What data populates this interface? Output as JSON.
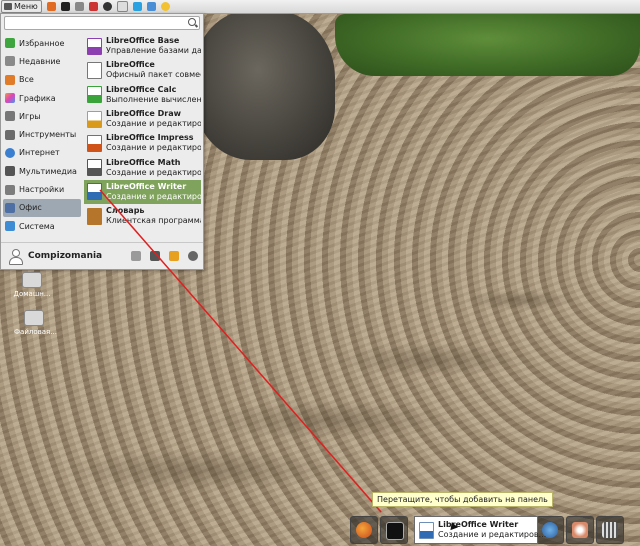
{
  "top_panel": {
    "menu_label": "Меню",
    "launchers": [
      "firefox-icon",
      "terminal-icon",
      "files-icon",
      "chromium-icon",
      "settings-icon",
      "folder-icon",
      "skype-icon",
      "mail-icon",
      "smile-icon"
    ]
  },
  "menu": {
    "search_placeholder": "",
    "categories": [
      {
        "label": "Избранное",
        "icon": "favorites-icon",
        "color": "#3fa63f"
      },
      {
        "label": "Недавние",
        "icon": "recent-icon",
        "color": "#8a8a8a"
      },
      {
        "label": "Все",
        "icon": "all-icon",
        "color": "#e07b2a"
      },
      {
        "label": "Графика",
        "icon": "graphics-icon",
        "color": "#d94fb0"
      },
      {
        "label": "Игры",
        "icon": "games-icon",
        "color": "#777777"
      },
      {
        "label": "Инструменты",
        "icon": "tools-icon",
        "color": "#6b6b6b"
      },
      {
        "label": "Интернет",
        "icon": "internet-icon",
        "color": "#3b7fd1"
      },
      {
        "label": "Мультимедиа",
        "icon": "multimedia-icon",
        "color": "#555555"
      },
      {
        "label": "Настройки",
        "icon": "settings-icon",
        "color": "#7d7d7d"
      },
      {
        "label": "Офис",
        "icon": "office-icon",
        "color": "#4d6fa3"
      },
      {
        "label": "Система",
        "icon": "system-icon",
        "color": "#3e8dd4"
      }
    ],
    "active_category": "Офис",
    "apps": [
      {
        "name": "LibreOffice Base",
        "desc": "Управление базами дан...",
        "icon": "libreoffice-base-icon",
        "accent": "#8b3fb0"
      },
      {
        "name": "LibreOffice",
        "desc": "Офисный пакет совмес...",
        "icon": "libreoffice-icon",
        "accent": "#777777"
      },
      {
        "name": "LibreOffice Calc",
        "desc": "Выполнение вычислен...",
        "icon": "libreoffice-calc-icon",
        "accent": "#3aa33a"
      },
      {
        "name": "LibreOffice Draw",
        "desc": "Создание и редактиров...",
        "icon": "libreoffice-draw-icon",
        "accent": "#d99a1c"
      },
      {
        "name": "LibreOffice Impress",
        "desc": "Создание и редактиров...",
        "icon": "libreoffice-impress-icon",
        "accent": "#d0541a"
      },
      {
        "name": "LibreOffice Math",
        "desc": "Создание и редактиров...",
        "icon": "libreoffice-math-icon",
        "accent": "#555555"
      },
      {
        "name": "LibreOffice Writer",
        "desc": "Создание и редактиров...",
        "icon": "libreoffice-writer-icon",
        "accent": "#2f6cb3"
      },
      {
        "name": "Словарь",
        "desc": "Клиентская программа ...",
        "icon": "dictionary-icon",
        "accent": "#b5762c"
      }
    ],
    "highlighted_app": "LibreOffice Writer",
    "user_name": "Compizomania",
    "footer_buttons": [
      "screensaver-icon",
      "lock-icon",
      "logout-icon",
      "shutdown-icon"
    ]
  },
  "desktop_icons": [
    {
      "label": "Домашн...",
      "icon": "home-folder-icon"
    },
    {
      "label": "Файловая...",
      "icon": "drive-icon"
    }
  ],
  "tooltip": "Перетащите, чтобы добавить на панель",
  "dragged_item": {
    "name": "LibreOffice Writer",
    "desc": "Создание и редактиров..."
  },
  "taskbar": {
    "items": [
      "firefox-icon",
      "terminal-icon",
      "thunderbird-icon",
      "eye-icon",
      "mixer-icon"
    ]
  },
  "colors": {
    "highlight": "#7fa25c",
    "active_category": "#9ea8b3",
    "tooltip_bg": "#ffffcc",
    "drag_line": "#e02020"
  }
}
